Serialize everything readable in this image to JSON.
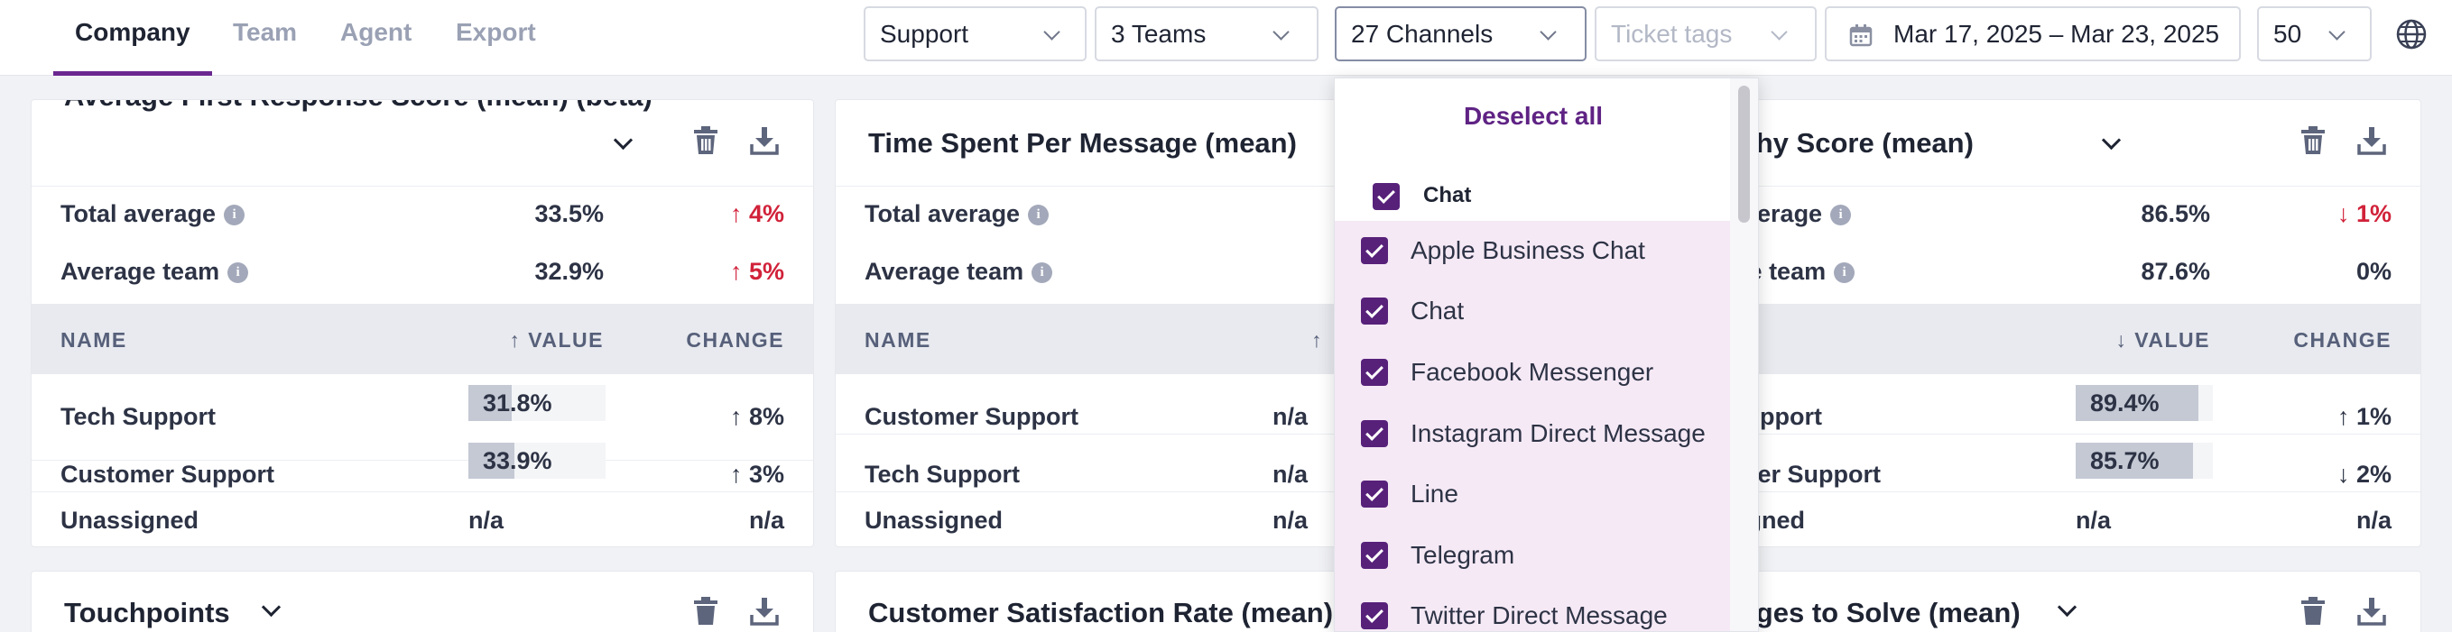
{
  "tabs": [
    {
      "label": "Company",
      "active": true
    },
    {
      "label": "Team",
      "active": false
    },
    {
      "label": "Agent",
      "active": false
    },
    {
      "label": "Export",
      "active": false
    }
  ],
  "filters": {
    "department": "Support",
    "teams": "3 Teams",
    "channels": "27 Channels",
    "ticket_tags_placeholder": "Ticket tags",
    "date_range": "Mar 17, 2025 – Mar 23, 2025",
    "page_size": "50"
  },
  "cards": [
    {
      "title": "Average First Response Score (mean) (beta)",
      "total_label": "Total average",
      "total_value": "33.5%",
      "total_change": "4%",
      "total_change_dir": "up",
      "team_label": "Average team",
      "team_value": "32.9%",
      "team_change": "5%",
      "team_change_dir": "up",
      "col_name": "NAME",
      "col_value": "VALUE",
      "col_change": "CHANGE",
      "rows": [
        {
          "name": "Tech Support",
          "value": "31.8%",
          "fraction": 0.318,
          "change": "8%",
          "dir": "up"
        },
        {
          "name": "Customer Support",
          "value": "33.9%",
          "fraction": 0.339,
          "change": "3%",
          "dir": "up"
        },
        {
          "name": "Unassigned",
          "value": "n/a",
          "change": "n/a"
        }
      ]
    },
    {
      "title": "Time Spent Per Message (mean)",
      "total_label": "Total average",
      "team_label": "Average team",
      "col_name": "NAME",
      "rows": [
        {
          "name": "Customer Support",
          "value": "n/a"
        },
        {
          "name": "Tech Support",
          "value": "n/a"
        },
        {
          "name": "Unassigned",
          "value": "n/a"
        }
      ]
    },
    {
      "title": "Empathy Score (mean)",
      "total_label": "Total average",
      "total_value": "86.5%",
      "total_change": "1%",
      "total_change_dir": "down",
      "team_label": "Average team",
      "team_value": "87.6%",
      "team_change": "0%",
      "col_value": "VALUE",
      "col_change": "CHANGE",
      "rows": [
        {
          "name": "Tech Support",
          "value": "89.4%",
          "fraction": 0.894,
          "change": "1%",
          "dir": "up"
        },
        {
          "name": "Customer Support",
          "value": "85.7%",
          "fraction": 0.857,
          "change": "2%",
          "dir": "down"
        },
        {
          "name": "Unassigned",
          "value": "n/a",
          "change": "n/a"
        }
      ]
    }
  ],
  "bottom_cards": [
    {
      "title": "Touchpoints"
    },
    {
      "title": "Customer Satisfaction Rate (mean)"
    },
    {
      "title": "Messages to Solve (mean)"
    }
  ],
  "channel_dropdown": {
    "deselect_label": "Deselect all",
    "group_label": "Chat",
    "items": [
      "Apple Business Chat",
      "Chat",
      "Facebook Messenger",
      "Instagram Direct Message",
      "Line",
      "Telegram",
      "Twitter Direct Message"
    ]
  },
  "colors": {
    "accent": "#6a2790",
    "checkbox": "#57217a",
    "up_bad": "#d1223a",
    "up_good": "#1e9a43",
    "dropdown_highlight": "#f5e9f5"
  }
}
